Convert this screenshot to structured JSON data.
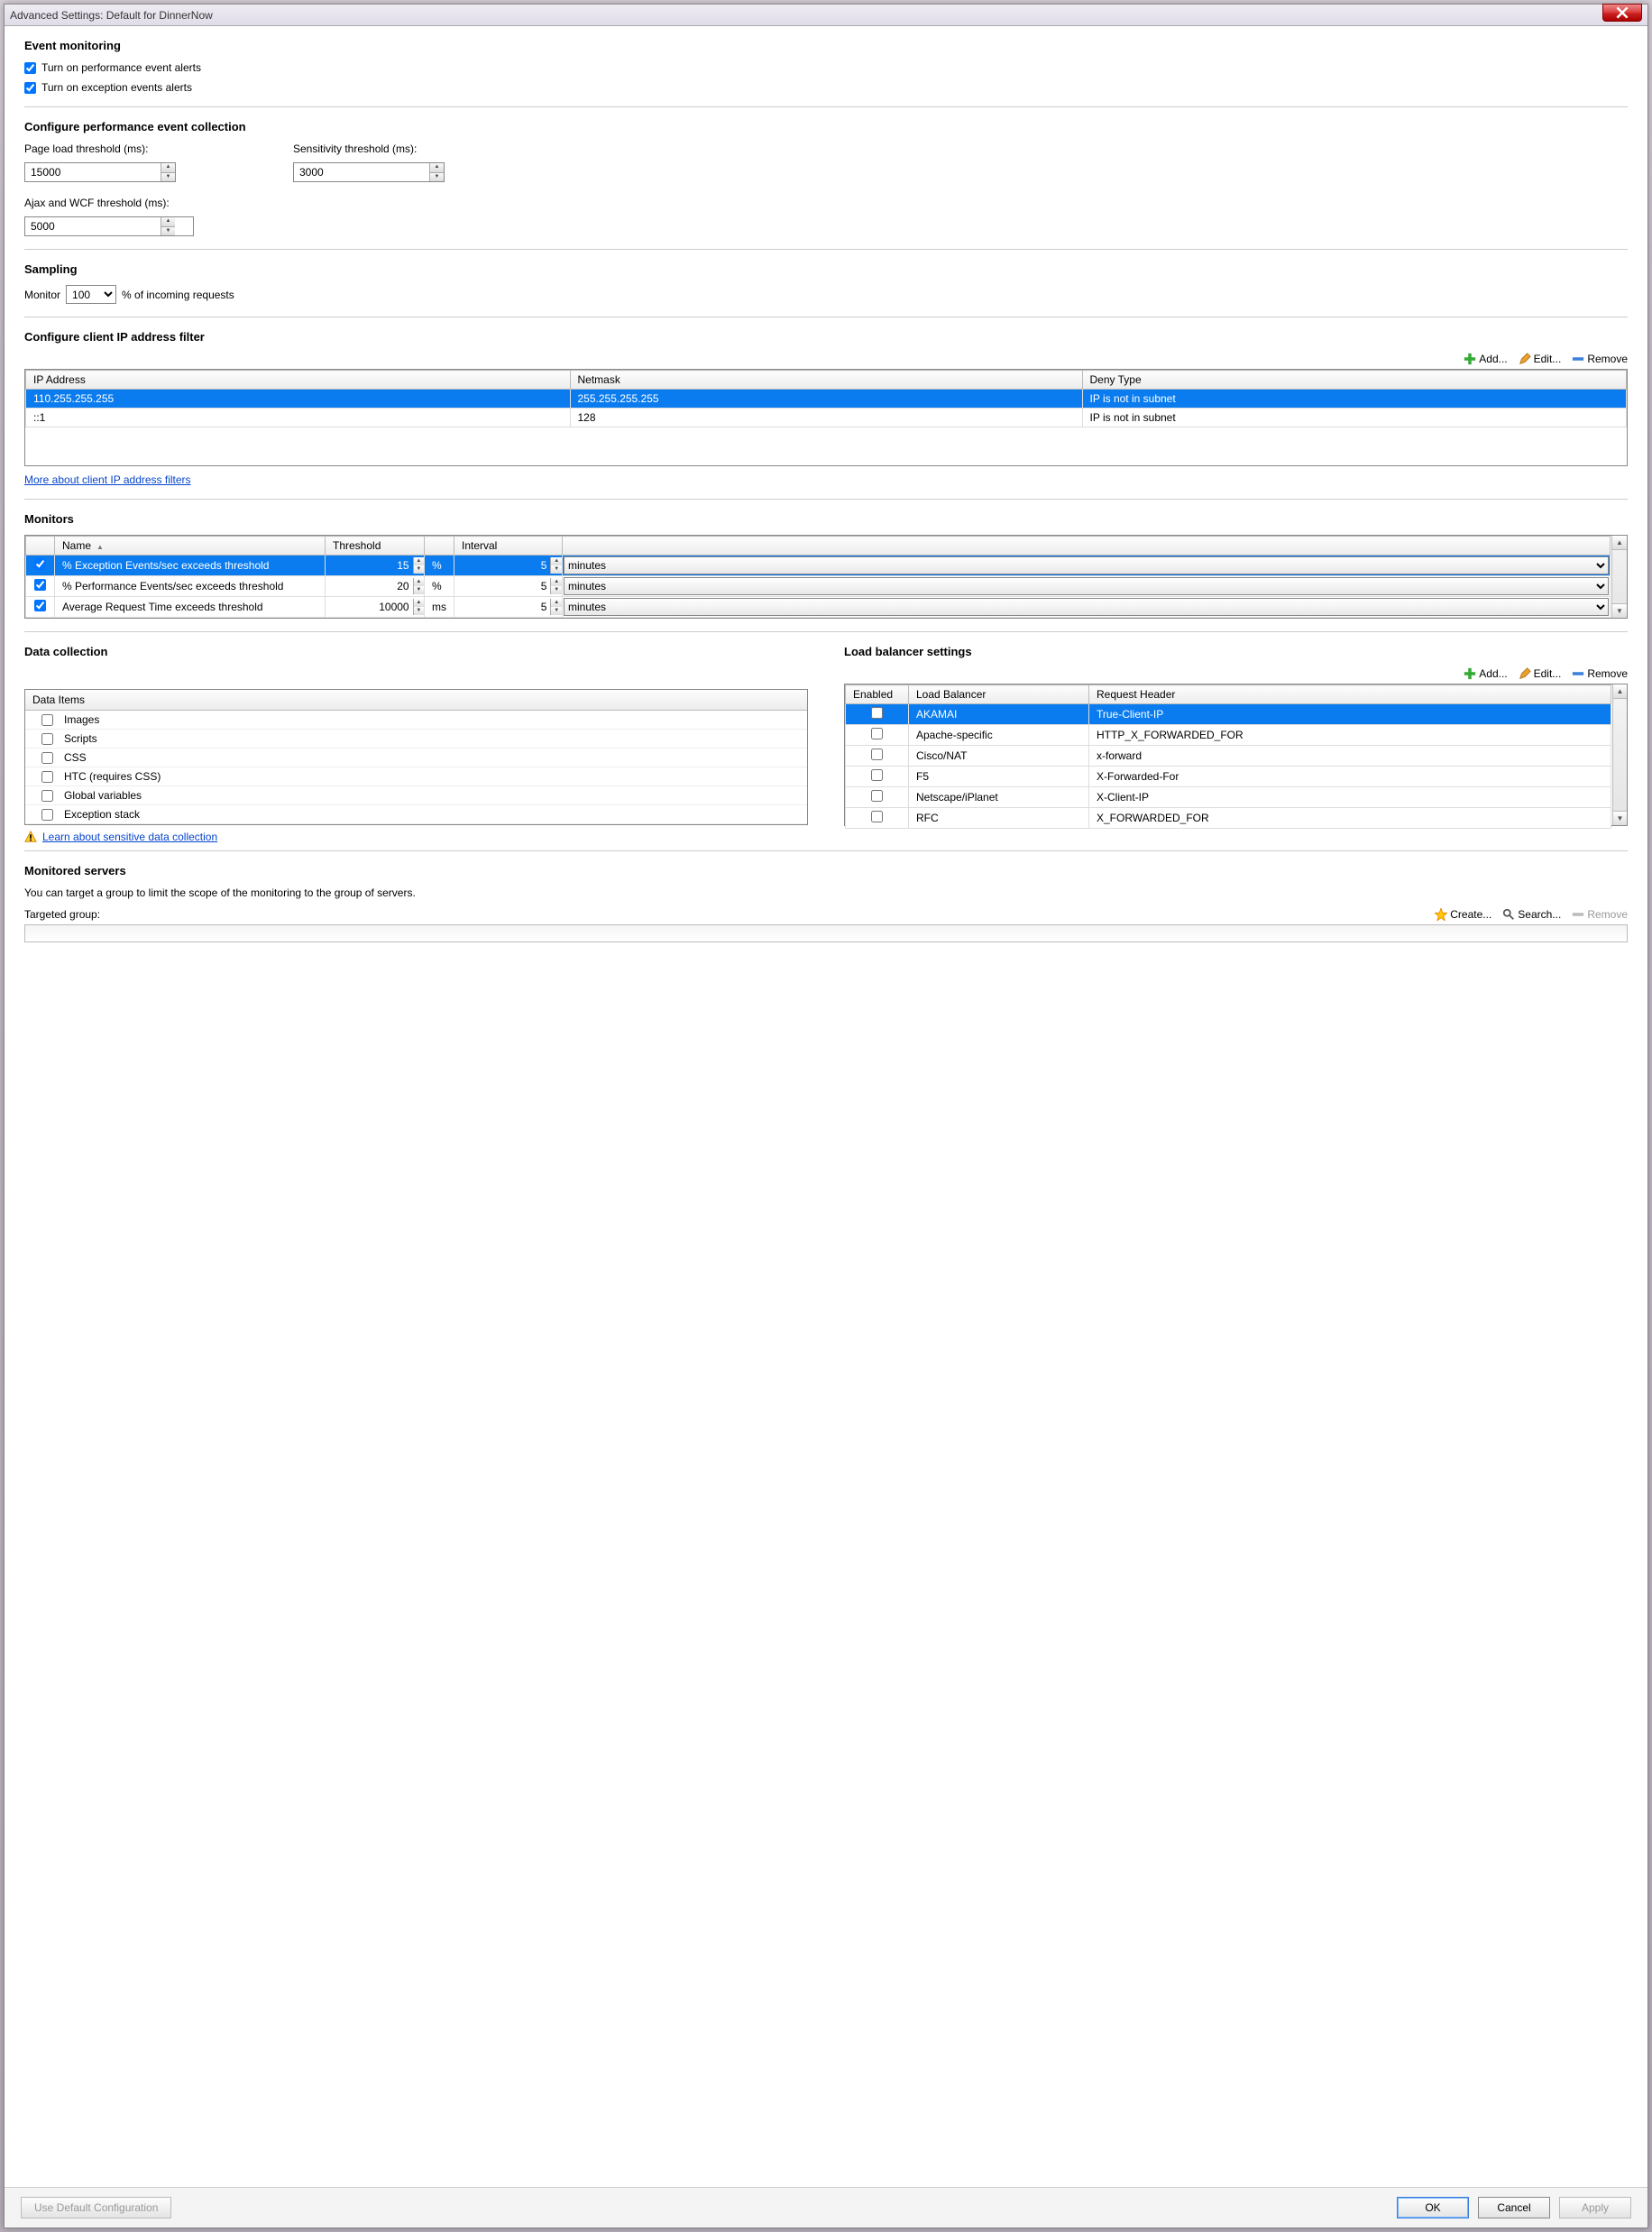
{
  "title": "Advanced Settings: Default for DinnerNow",
  "eventMonitoring": {
    "heading": "Event monitoring",
    "perfAlertsLabel": "Turn on performance event alerts",
    "exceptionAlertsLabel": "Turn on exception events alerts"
  },
  "perfCollection": {
    "heading": "Configure performance event collection",
    "pageLoadLabel": "Page load threshold (ms):",
    "pageLoadValue": "15000",
    "sensitivityLabel": "Sensitivity threshold (ms):",
    "sensitivityValue": "3000",
    "ajaxLabel": "Ajax and WCF threshold (ms):",
    "ajaxValue": "5000"
  },
  "sampling": {
    "heading": "Sampling",
    "prefix": "Monitor",
    "value": "100",
    "suffix": "% of incoming requests"
  },
  "ipFilter": {
    "heading": "Configure client IP address filter",
    "addLabel": "Add...",
    "editLabel": "Edit...",
    "removeLabel": "Remove",
    "cols": {
      "ip": "IP Address",
      "netmask": "Netmask",
      "deny": "Deny Type"
    },
    "rows": [
      {
        "ip": "110.255.255.255",
        "netmask": "255.255.255.255",
        "deny": "IP is not in subnet",
        "selected": true
      },
      {
        "ip": "::1",
        "netmask": "128",
        "deny": "IP is not in subnet",
        "selected": false
      }
    ],
    "moreLink": "More about client IP address filters"
  },
  "monitors": {
    "heading": "Monitors",
    "cols": {
      "name": "Name",
      "threshold": "Threshold",
      "interval": "Interval"
    },
    "rows": [
      {
        "name": "% Exception Events/sec exceeds threshold",
        "threshold": "15",
        "unit": "%",
        "interval": "5",
        "intervalUnit": "minutes",
        "selected": true
      },
      {
        "name": "% Performance Events/sec exceeds threshold",
        "threshold": "20",
        "unit": "%",
        "interval": "5",
        "intervalUnit": "minutes",
        "selected": false
      },
      {
        "name": "Average Request Time exceeds threshold",
        "threshold": "10000",
        "unit": "ms",
        "interval": "5",
        "intervalUnit": "minutes",
        "selected": false
      }
    ]
  },
  "dataCollection": {
    "heading": "Data collection",
    "itemsHeader": "Data Items",
    "items": [
      "Images",
      "Scripts",
      "CSS",
      "HTC (requires CSS)",
      "Global variables",
      "Exception stack"
    ],
    "learnLink": "Learn about sensitive data collection"
  },
  "loadBalancer": {
    "heading": "Load balancer settings",
    "addLabel": "Add...",
    "editLabel": "Edit...",
    "removeLabel": "Remove",
    "cols": {
      "enabled": "Enabled",
      "name": "Load Balancer",
      "header": "Request Header"
    },
    "rows": [
      {
        "name": "AKAMAI",
        "header": "True-Client-IP",
        "selected": true
      },
      {
        "name": "Apache-specific",
        "header": "HTTP_X_FORWARDED_FOR",
        "selected": false
      },
      {
        "name": "Cisco/NAT",
        "header": "x-forward",
        "selected": false
      },
      {
        "name": "F5",
        "header": "X-Forwarded-For",
        "selected": false
      },
      {
        "name": "Netscape/iPlanet",
        "header": "X-Client-IP",
        "selected": false
      },
      {
        "name": "RFC",
        "header": "X_FORWARDED_FOR",
        "selected": false
      }
    ]
  },
  "monitoredServers": {
    "heading": "Monitored servers",
    "desc": "You can target a group to limit the scope of the monitoring to the group of servers.",
    "targetedLabel": "Targeted group:",
    "createLabel": "Create...",
    "searchLabel": "Search...",
    "removeLabel": "Remove"
  },
  "footer": {
    "defaultConfig": "Use Default Configuration",
    "ok": "OK",
    "cancel": "Cancel",
    "apply": "Apply"
  }
}
